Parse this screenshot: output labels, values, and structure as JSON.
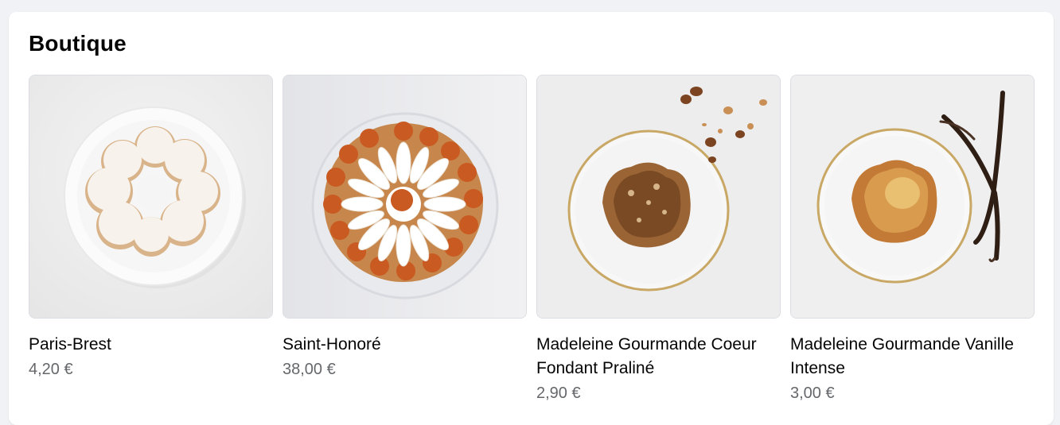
{
  "section": {
    "title": "Boutique"
  },
  "products": [
    {
      "name": "Paris-Brest",
      "price": "4,20 €",
      "image_icon": "paris-brest-photo"
    },
    {
      "name": "Saint-Honoré",
      "price": "38,00 €",
      "image_icon": "saint-honore-photo"
    },
    {
      "name": "Madeleine Gourmande Coeur Fondant Praliné",
      "price": "2,90 €",
      "image_icon": "madeleine-praline-photo"
    },
    {
      "name": "Madeleine Gourmande Vanille Intense",
      "price": "3,00 €",
      "image_icon": "madeleine-vanille-photo"
    }
  ],
  "colors": {
    "page_bg": "#f0f2f5",
    "card_bg": "#ffffff",
    "price": "#65676b",
    "title": "#050505"
  }
}
